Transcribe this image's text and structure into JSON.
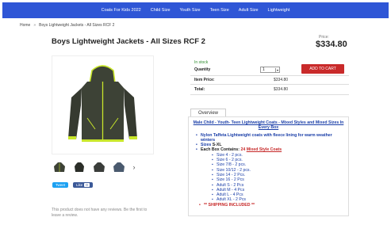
{
  "nav": {
    "items": [
      "Coats For Kids 2022",
      "Child Size",
      "Youth Size",
      "Teen Size",
      "Adult Size",
      "Lightweight"
    ]
  },
  "breadcrumb": {
    "home": "Home",
    "separator": "»",
    "current": "Boys Lightweight Jackets - All Sizes RCF 2"
  },
  "product": {
    "title": "Boys Lightweight Jackets - All Sizes RCF 2",
    "price_label": "Price:",
    "price": "$334.80"
  },
  "buy": {
    "stock_status": "In stock",
    "quantity_label": "Quantity",
    "quantity_value": "1",
    "add_to_cart": "ADD TO CART",
    "item_price_label": "Item Price:",
    "item_price_value": "$334.80",
    "total_label": "Total:",
    "total_value": "$334.80"
  },
  "social": {
    "tweet": "Tweet",
    "like": "Like",
    "like_count": "0"
  },
  "reviews": {
    "text": "This product does not have any reviews. Be the first to leave a review."
  },
  "overview": {
    "tab_label": "Overview",
    "heading": "Male Child - Youth- Teen Lightweight Coats - Mixed Styles and Mixed Sizes In Every Box",
    "bullet1": "Nylon Taffeta Lightweight coats with fleece lining for warm weather winters",
    "bullet2_label": "Sizes",
    "bullet2_value": "S-XL",
    "bullet3_prefix": "Each Box Contains:",
    "bullet3_count": "24",
    "bullet3_link": "Mixed Style Coats",
    "sizes": [
      "Size 4 - 2 pcs.",
      "Size 6 - 2 pcs.",
      "Size 7/8 - 2 pcs.",
      "Size 10/12 - 2 pcs.",
      "Size 14 - 2 Pcs.",
      "Size 16 - 2 Pcs",
      "Adult S - 2 Pcs",
      "Adult M - 4 Pcs",
      "Adult L - 4 Pcs",
      "Adult XL - 2 Pcs"
    ],
    "shipping": "** SHIPPING INCLUDED **"
  },
  "colors": {
    "nav_bg": "#2f56d6",
    "cart_button": "#c92a2a",
    "link_blue": "#1a3ea8",
    "jacket_body": "#3d4236",
    "jacket_trim": "#c8e62a"
  }
}
